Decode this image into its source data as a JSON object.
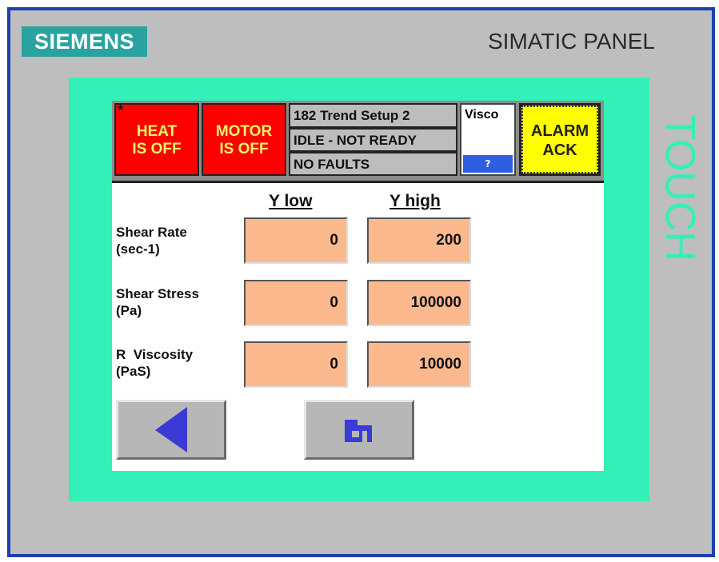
{
  "device": {
    "brand": "SIEMENS",
    "model": "SIMATIC PANEL",
    "side_label": "TOUCH"
  },
  "header": {
    "heat": {
      "marker": "*",
      "line1": "HEAT",
      "line2": "IS OFF"
    },
    "motor": {
      "line1": "MOTOR",
      "line2": "IS OFF"
    },
    "screen_title": "182 Trend Setup 2",
    "state": "IDLE - NOT READY",
    "faults": "NO FAULTS",
    "mode_label": "Visco",
    "help_label": "?",
    "alarm": {
      "line1": "ALARM",
      "line2": "ACK"
    }
  },
  "table": {
    "col_low": "Y low",
    "col_high": "Y high",
    "rows": [
      {
        "label1": "Shear Rate",
        "label2": "(sec-1)",
        "low": "0",
        "high": "200"
      },
      {
        "label1": "Shear Stress",
        "label2": "(Pa)",
        "low": "0",
        "high": "100000"
      },
      {
        "label1": "R  Viscosity",
        "label2": "(PaS)",
        "low": "0",
        "high": "10000"
      }
    ]
  },
  "colors": {
    "frame_border": "#1e3fb0",
    "bezel": "#33f0b8",
    "logo_bg": "#2aa3a0",
    "status_red": "#ff0000",
    "status_text_yellow": "#f3f36a",
    "alarm_yellow": "#ffff00",
    "input_orange": "#fbb98d",
    "help_blue": "#2e5fe0"
  },
  "icons": {
    "back": "left-triangle-arrow",
    "home": "factory-building"
  }
}
